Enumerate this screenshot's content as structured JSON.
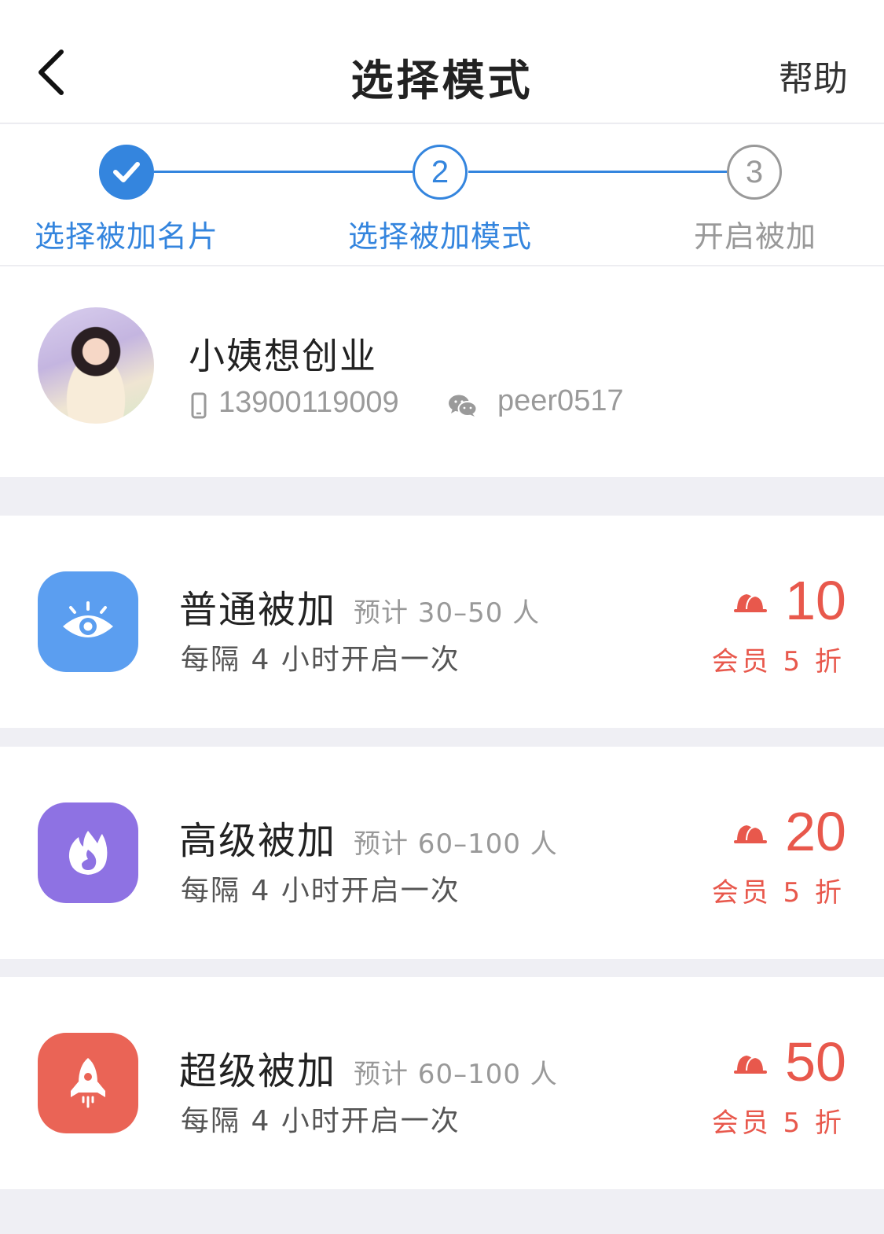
{
  "navbar": {
    "title": "选择模式",
    "help_label": "帮助"
  },
  "steps": [
    {
      "label": "选择被加名片",
      "state": "done",
      "number": ""
    },
    {
      "label": "选择被加模式",
      "state": "active",
      "number": "2"
    },
    {
      "label": "开启被加",
      "state": "todo",
      "number": "3"
    }
  ],
  "profile": {
    "name": "小姨想创业",
    "phone": "13900119009",
    "wechat": "peer0517"
  },
  "modes": [
    {
      "title": "普通被加",
      "estimate": "预计 30–50 人",
      "desc": "每隔 4 小时开启一次",
      "price": "10",
      "discount": "会员 5 折",
      "icon": "eye-icon",
      "color": "#5b9ef0"
    },
    {
      "title": "高级被加",
      "estimate": "预计 60–100 人",
      "desc": "每隔 4 小时开启一次",
      "price": "20",
      "discount": "会员 5 折",
      "icon": "flame-icon",
      "color": "#8e72e3"
    },
    {
      "title": "超级被加",
      "estimate": "预计 60–100 人",
      "desc": "每隔 4 小时开启一次",
      "price": "50",
      "discount": "会员 5 折",
      "icon": "rocket-icon",
      "color": "#ea6456"
    }
  ],
  "colors": {
    "primary": "#3485de",
    "price": "#e8584c",
    "background": "#efeff4"
  }
}
